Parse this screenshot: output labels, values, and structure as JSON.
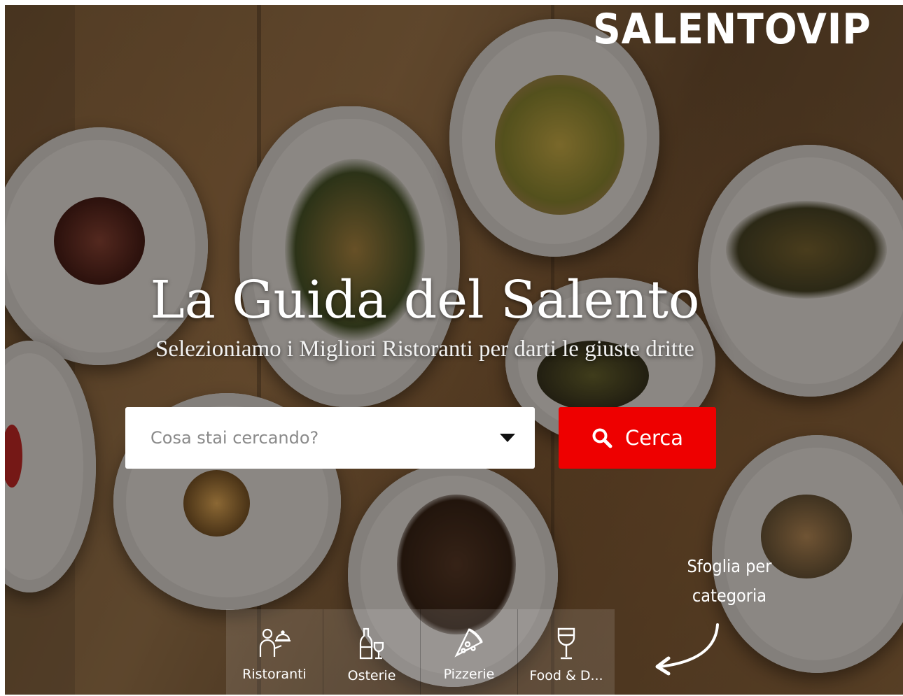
{
  "brand": {
    "logo_text": "SALENTOVIP"
  },
  "hero": {
    "title": "La Guida del Salento",
    "subtitle": "Selezioniamo i Migliori Ristoranti per darti le giuste dritte"
  },
  "search": {
    "placeholder": "Cosa stai cercando?",
    "button_label": "Cerca",
    "button_color": "#ee0000"
  },
  "browse_hint": {
    "line1": "Sfoglia per",
    "line2": "categoria"
  },
  "categories": [
    {
      "label": "Ristoranti",
      "icon": "waiter-cloche-icon"
    },
    {
      "label": "Osterie",
      "icon": "wine-bottle-glass-icon"
    },
    {
      "label": "Pizzerie",
      "icon": "pizza-slice-icon"
    },
    {
      "label": "Food & D...",
      "icon": "wine-glass-icon"
    }
  ]
}
